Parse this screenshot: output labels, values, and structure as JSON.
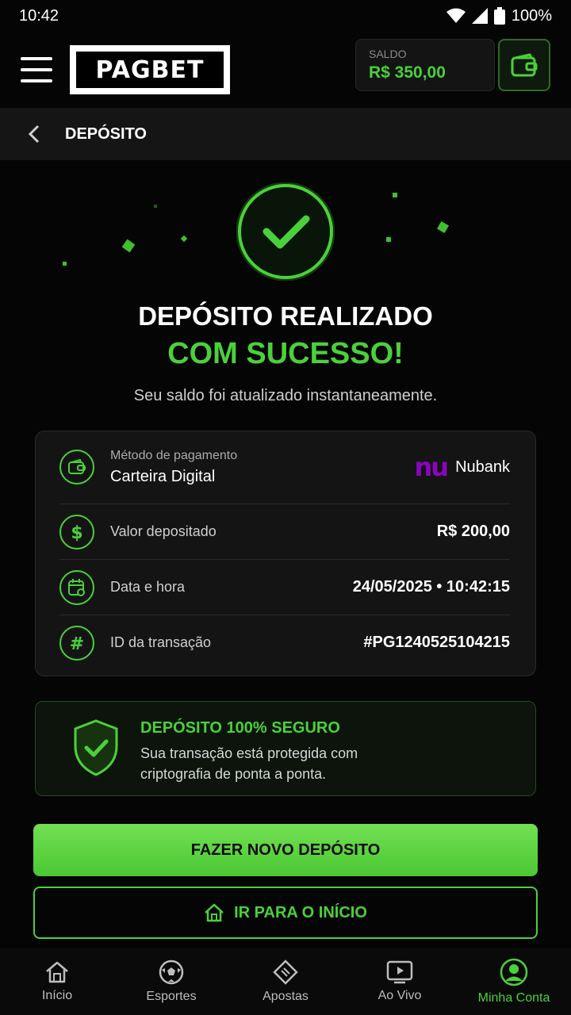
{
  "status_bar": {
    "time": "10:42",
    "battery": "100%"
  },
  "header": {
    "logo": "PAGBET",
    "balance_label": "SALDO",
    "balance_value": "R$ 350,00"
  },
  "subheader": {
    "title": "DEPÓSITO"
  },
  "success": {
    "title_line1": "DEPÓSITO REALIZADO",
    "title_line2": "COM SUCESSO!",
    "subtitle": "Seu saldo foi atualizado instantaneamente."
  },
  "details": {
    "method_label": "Método de pagamento",
    "method_value": "Carteira Digital",
    "bank_logo": "nu",
    "bank_name": "Nubank",
    "amount_label": "Valor depositado",
    "amount_value": "R$ 200,00",
    "datetime_label": "Data e hora",
    "datetime_value": "24/05/2025 • 10:42:15",
    "transaction_label": "ID da transação",
    "transaction_value": "#PG1240525104215"
  },
  "secure": {
    "title": "DEPÓSITO 100% SEGURO",
    "text": "Sua transação está protegida com criptografia de ponta a ponta."
  },
  "buttons": {
    "new_deposit": "FAZER NOVO DEPÓSITO",
    "go_home": "IR PARA O INÍCIO"
  },
  "bottom_nav": [
    {
      "label": "Início",
      "icon": "home-icon"
    },
    {
      "label": "Esportes",
      "icon": "soccer-ball-icon"
    },
    {
      "label": "Apostas",
      "icon": "ticket-icon"
    },
    {
      "label": "Ao Vivo",
      "icon": "play-icon"
    },
    {
      "label": "Minha Conta",
      "icon": "user-icon",
      "active": true
    }
  ],
  "colors": {
    "accent": "#4ad13a",
    "background": "#050505",
    "nubank": "#8a05be"
  }
}
